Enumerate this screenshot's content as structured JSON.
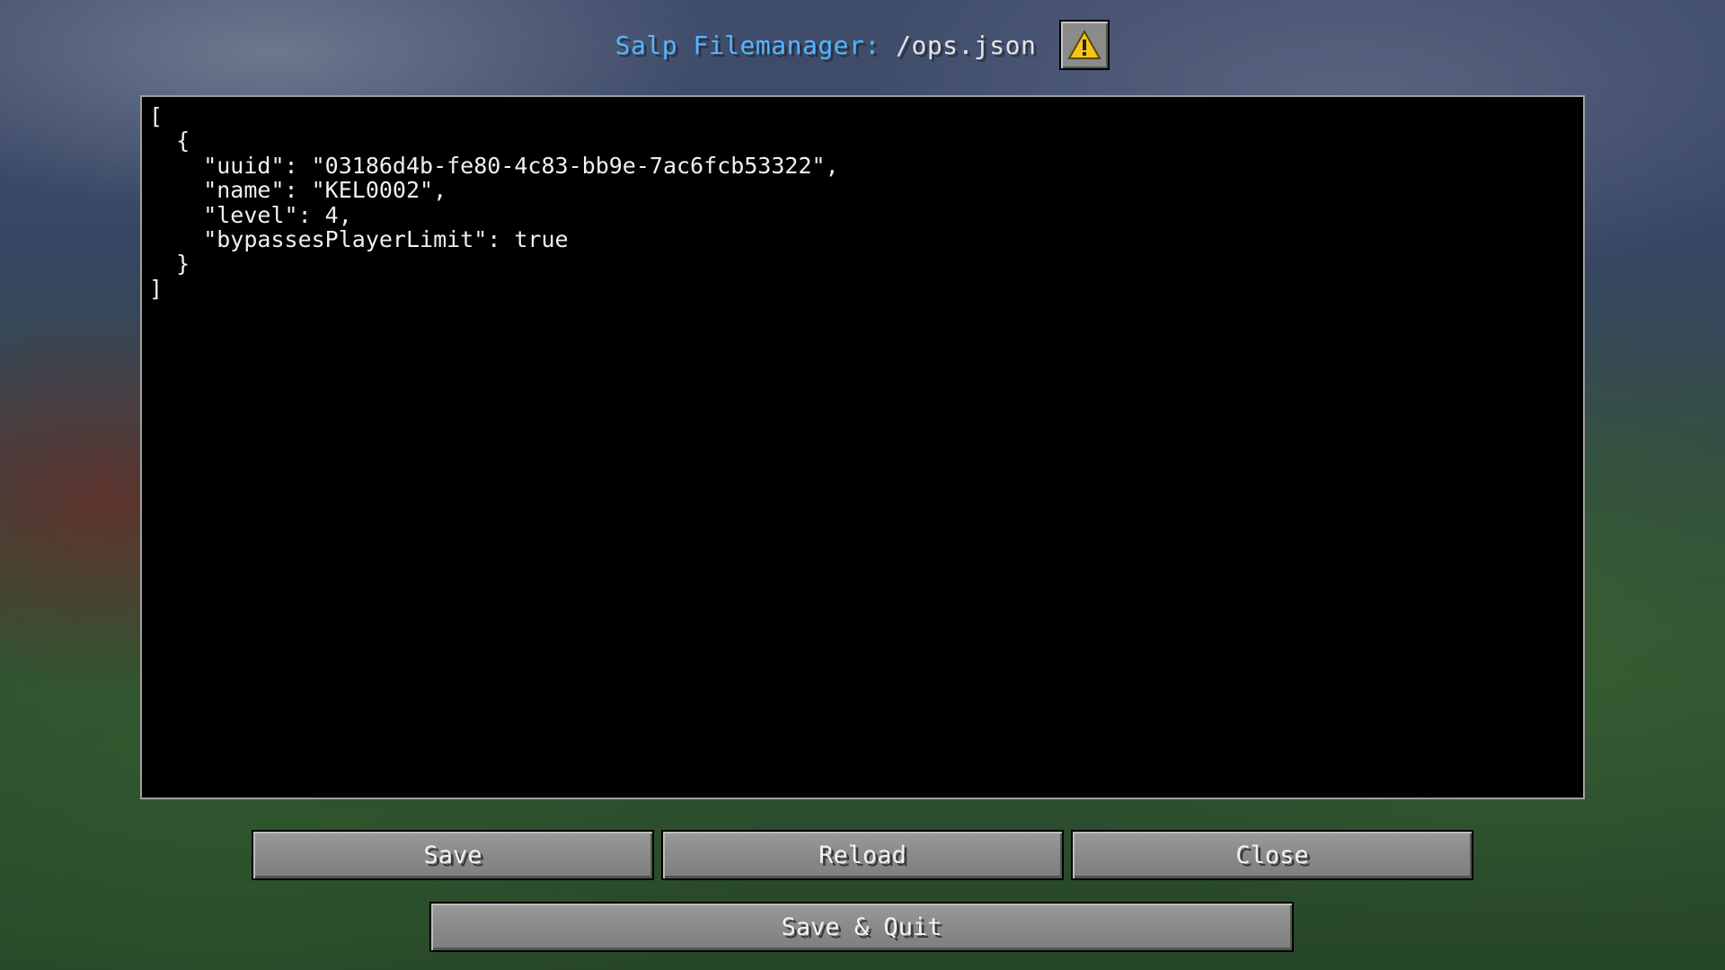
{
  "header": {
    "app_label": "Salp Filemanager:",
    "file_path": " /ops.json",
    "warning_icon": "warning-triangle-icon"
  },
  "editor": {
    "content": "[\n  {\n    \"uuid\": \"03186d4b-fe80-4c83-bb9e-7ac6fcb53322\",\n    \"name\": \"KEL0002\",\n    \"level\": 4,\n    \"bypassesPlayerLimit\": true\n  }\n]"
  },
  "buttons": {
    "save": "Save",
    "reload": "Reload",
    "close": "Close",
    "save_quit": "Save & Quit"
  },
  "colors": {
    "app_label": "#55b6ff",
    "warning_fill": "#f5c518"
  }
}
